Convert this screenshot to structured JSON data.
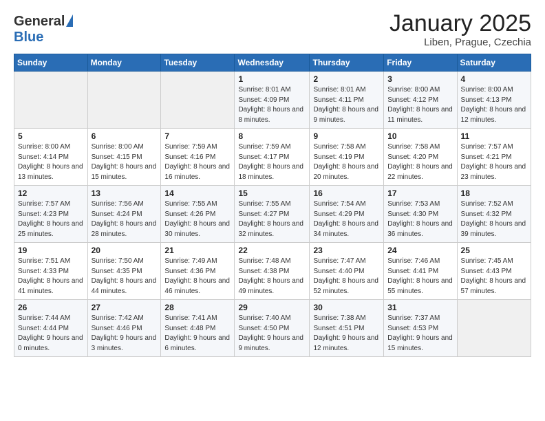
{
  "header": {
    "logo_general": "General",
    "logo_blue": "Blue",
    "title": "January 2025",
    "location": "Liben, Prague, Czechia"
  },
  "calendar": {
    "weekdays": [
      "Sunday",
      "Monday",
      "Tuesday",
      "Wednesday",
      "Thursday",
      "Friday",
      "Saturday"
    ],
    "weeks": [
      [
        {
          "day": "",
          "info": ""
        },
        {
          "day": "",
          "info": ""
        },
        {
          "day": "",
          "info": ""
        },
        {
          "day": "1",
          "info": "Sunrise: 8:01 AM\nSunset: 4:09 PM\nDaylight: 8 hours and 8 minutes."
        },
        {
          "day": "2",
          "info": "Sunrise: 8:01 AM\nSunset: 4:11 PM\nDaylight: 8 hours and 9 minutes."
        },
        {
          "day": "3",
          "info": "Sunrise: 8:00 AM\nSunset: 4:12 PM\nDaylight: 8 hours and 11 minutes."
        },
        {
          "day": "4",
          "info": "Sunrise: 8:00 AM\nSunset: 4:13 PM\nDaylight: 8 hours and 12 minutes."
        }
      ],
      [
        {
          "day": "5",
          "info": "Sunrise: 8:00 AM\nSunset: 4:14 PM\nDaylight: 8 hours and 13 minutes."
        },
        {
          "day": "6",
          "info": "Sunrise: 8:00 AM\nSunset: 4:15 PM\nDaylight: 8 hours and 15 minutes."
        },
        {
          "day": "7",
          "info": "Sunrise: 7:59 AM\nSunset: 4:16 PM\nDaylight: 8 hours and 16 minutes."
        },
        {
          "day": "8",
          "info": "Sunrise: 7:59 AM\nSunset: 4:17 PM\nDaylight: 8 hours and 18 minutes."
        },
        {
          "day": "9",
          "info": "Sunrise: 7:58 AM\nSunset: 4:19 PM\nDaylight: 8 hours and 20 minutes."
        },
        {
          "day": "10",
          "info": "Sunrise: 7:58 AM\nSunset: 4:20 PM\nDaylight: 8 hours and 22 minutes."
        },
        {
          "day": "11",
          "info": "Sunrise: 7:57 AM\nSunset: 4:21 PM\nDaylight: 8 hours and 23 minutes."
        }
      ],
      [
        {
          "day": "12",
          "info": "Sunrise: 7:57 AM\nSunset: 4:23 PM\nDaylight: 8 hours and 25 minutes."
        },
        {
          "day": "13",
          "info": "Sunrise: 7:56 AM\nSunset: 4:24 PM\nDaylight: 8 hours and 28 minutes."
        },
        {
          "day": "14",
          "info": "Sunrise: 7:55 AM\nSunset: 4:26 PM\nDaylight: 8 hours and 30 minutes."
        },
        {
          "day": "15",
          "info": "Sunrise: 7:55 AM\nSunset: 4:27 PM\nDaylight: 8 hours and 32 minutes."
        },
        {
          "day": "16",
          "info": "Sunrise: 7:54 AM\nSunset: 4:29 PM\nDaylight: 8 hours and 34 minutes."
        },
        {
          "day": "17",
          "info": "Sunrise: 7:53 AM\nSunset: 4:30 PM\nDaylight: 8 hours and 36 minutes."
        },
        {
          "day": "18",
          "info": "Sunrise: 7:52 AM\nSunset: 4:32 PM\nDaylight: 8 hours and 39 minutes."
        }
      ],
      [
        {
          "day": "19",
          "info": "Sunrise: 7:51 AM\nSunset: 4:33 PM\nDaylight: 8 hours and 41 minutes."
        },
        {
          "day": "20",
          "info": "Sunrise: 7:50 AM\nSunset: 4:35 PM\nDaylight: 8 hours and 44 minutes."
        },
        {
          "day": "21",
          "info": "Sunrise: 7:49 AM\nSunset: 4:36 PM\nDaylight: 8 hours and 46 minutes."
        },
        {
          "day": "22",
          "info": "Sunrise: 7:48 AM\nSunset: 4:38 PM\nDaylight: 8 hours and 49 minutes."
        },
        {
          "day": "23",
          "info": "Sunrise: 7:47 AM\nSunset: 4:40 PM\nDaylight: 8 hours and 52 minutes."
        },
        {
          "day": "24",
          "info": "Sunrise: 7:46 AM\nSunset: 4:41 PM\nDaylight: 8 hours and 55 minutes."
        },
        {
          "day": "25",
          "info": "Sunrise: 7:45 AM\nSunset: 4:43 PM\nDaylight: 8 hours and 57 minutes."
        }
      ],
      [
        {
          "day": "26",
          "info": "Sunrise: 7:44 AM\nSunset: 4:44 PM\nDaylight: 9 hours and 0 minutes."
        },
        {
          "day": "27",
          "info": "Sunrise: 7:42 AM\nSunset: 4:46 PM\nDaylight: 9 hours and 3 minutes."
        },
        {
          "day": "28",
          "info": "Sunrise: 7:41 AM\nSunset: 4:48 PM\nDaylight: 9 hours and 6 minutes."
        },
        {
          "day": "29",
          "info": "Sunrise: 7:40 AM\nSunset: 4:50 PM\nDaylight: 9 hours and 9 minutes."
        },
        {
          "day": "30",
          "info": "Sunrise: 7:38 AM\nSunset: 4:51 PM\nDaylight: 9 hours and 12 minutes."
        },
        {
          "day": "31",
          "info": "Sunrise: 7:37 AM\nSunset: 4:53 PM\nDaylight: 9 hours and 15 minutes."
        },
        {
          "day": "",
          "info": ""
        }
      ]
    ]
  }
}
